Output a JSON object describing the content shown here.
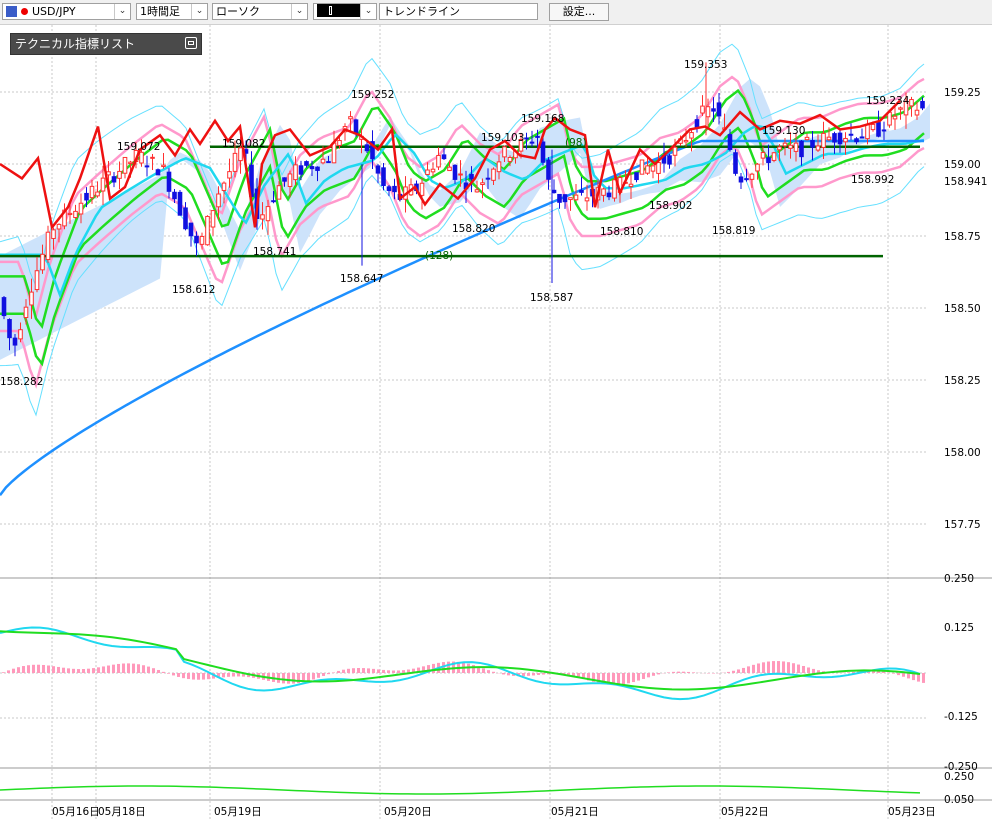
{
  "toolbar": {
    "symbol": "USD/JPY",
    "timeframe": "1時間足",
    "chart_type": "ローソク",
    "tool_box": "",
    "drawing_tool": "トレンドライン",
    "settings_label": "設定..."
  },
  "indicator_panel": {
    "title": "テクニカル指標リスト"
  },
  "colors": {
    "candle_up": "#ff3030",
    "candle_down": "#1010e0",
    "bb_outer": "#66e0ff",
    "bb_mid": "#ff99cc",
    "ma_green": "#20dd20",
    "ma_cyan": "#20d8f0",
    "ma_blue": "#1e90ff",
    "cloud": "#cde3fb",
    "red_line": "#ee1111",
    "h_line": "#006400",
    "hist": "#ff99bb"
  },
  "chart_data": {
    "type": "candlestick",
    "symbol": "USD/JPY",
    "y_ticks": [
      "159.25",
      "159.00",
      "158.75",
      "158.50",
      "158.25",
      "158.00",
      "157.75"
    ],
    "last_price": "158.941",
    "x_ticks": [
      "05月16日",
      "05月18日",
      "05月19日",
      "05月20日",
      "05月21日",
      "05月22日",
      "05月23日"
    ],
    "horizontal_lines": [
      159.06,
      158.68
    ],
    "annotations": [
      {
        "text": "159.353",
        "price": 159.353
      },
      {
        "text": "159.252",
        "price": 159.252
      },
      {
        "text": "159.234",
        "price": 159.234
      },
      {
        "text": "159.168",
        "price": 159.168
      },
      {
        "text": "159.130",
        "price": 159.13
      },
      {
        "text": "159.103",
        "price": 159.103
      },
      {
        "text": "159.082",
        "price": 159.082
      },
      {
        "text": "159.072",
        "price": 159.072
      },
      {
        "text": "(98)",
        "price": 159.09
      },
      {
        "text": "158.992",
        "price": 158.992
      },
      {
        "text": "158.902",
        "price": 158.902
      },
      {
        "text": "158.820",
        "price": 158.82
      },
      {
        "text": "158.819",
        "price": 158.819
      },
      {
        "text": "158.810",
        "price": 158.81
      },
      {
        "text": "158.741",
        "price": 158.741
      },
      {
        "text": "(128)",
        "price": 158.72
      },
      {
        "text": "158.647",
        "price": 158.647
      },
      {
        "text": "158.612",
        "price": 158.612
      },
      {
        "text": "158.587",
        "price": 158.587
      },
      {
        "text": "158.282",
        "price": 158.282
      }
    ],
    "macd_ticks": [
      "0.250",
      "0.125",
      "-0.125",
      "-0.250"
    ],
    "sub_ticks": [
      "0.250",
      "0.050"
    ]
  }
}
